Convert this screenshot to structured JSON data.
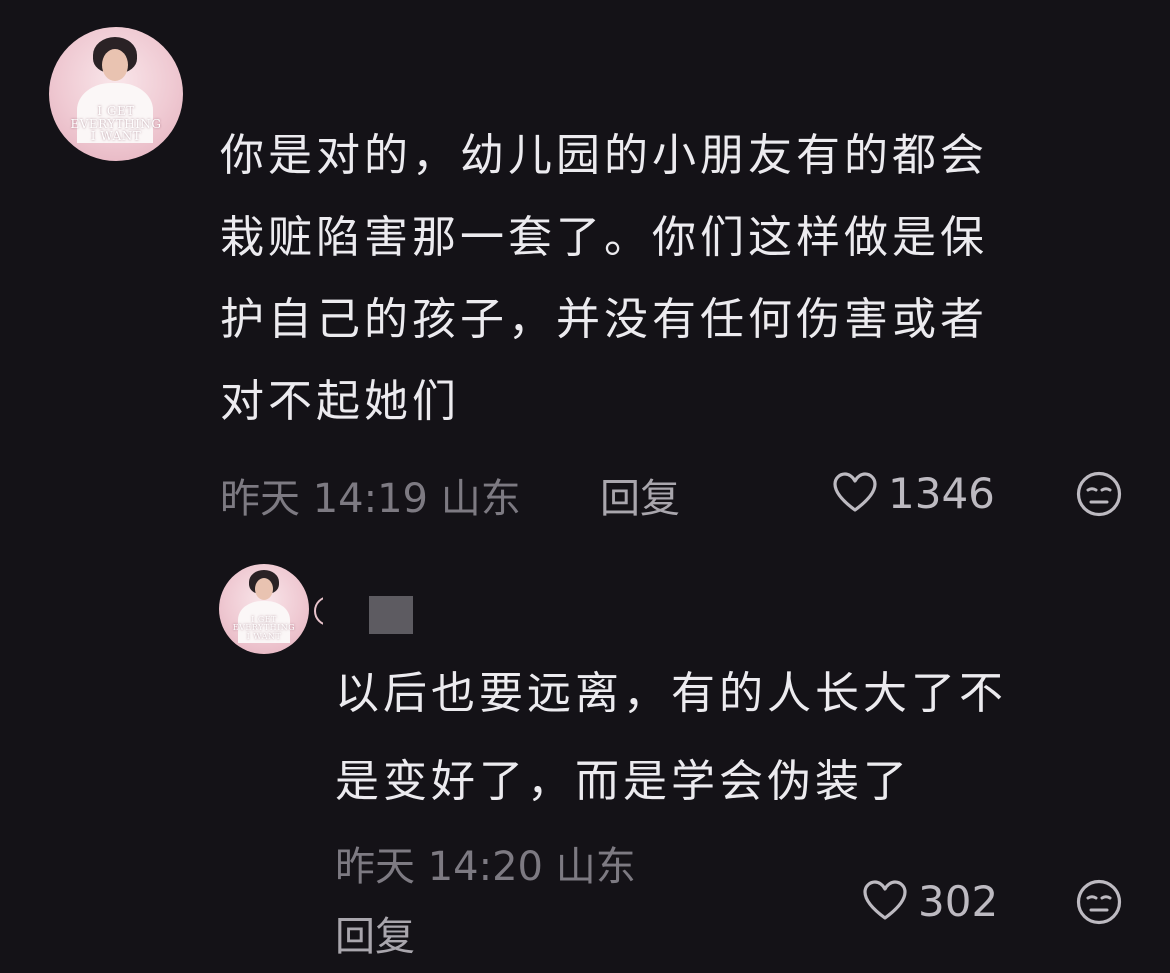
{
  "comment": {
    "avatar_caption": [
      "I GET",
      "EVERYTHING",
      "I WANT"
    ],
    "text_lines": [
      "你是对的，幼儿园的小朋友有的都会",
      "栽赃陷害那一套了。你们这样做是保",
      "护自己的孩子，并没有任何伤害或者",
      "对不起她们"
    ],
    "timestamp": "昨天 14:19 山东",
    "reply_label": "回复",
    "like_count": "1346"
  },
  "reply": {
    "avatar_caption": [
      "I GET",
      "EVERYTHING",
      "I WANT"
    ],
    "text_lines": [
      "以后也要远离，有的人长大了不",
      "是变好了，而是学会伪装了"
    ],
    "timestamp": "昨天 14:20 山东",
    "reply_label": "回复",
    "like_count": "302"
  },
  "icons": {
    "like": "heart-outline-icon",
    "dislike": "unamused-face-icon"
  },
  "colors": {
    "background": "#141217",
    "text": "#ecebef",
    "meta": "#7d7a82"
  }
}
